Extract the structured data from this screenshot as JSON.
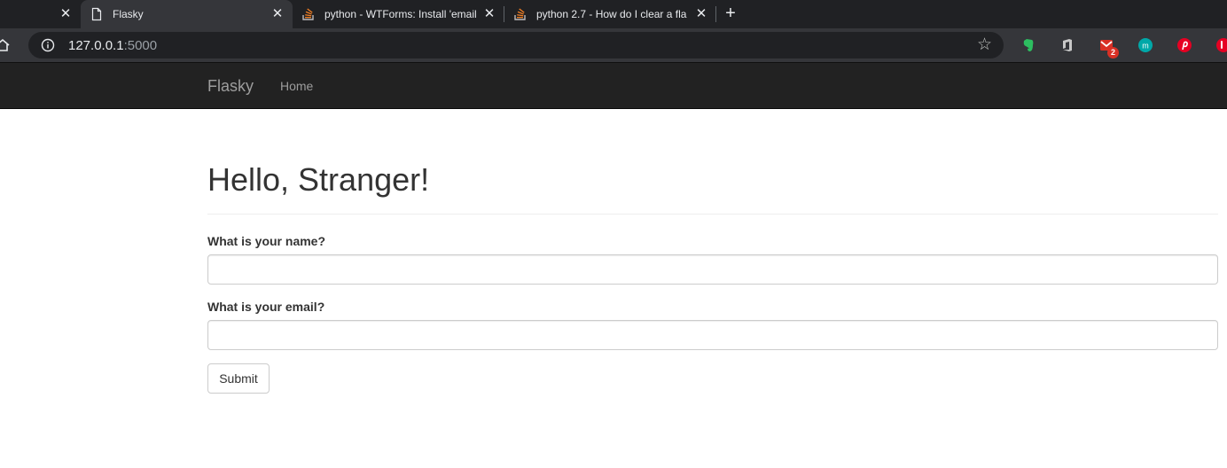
{
  "browser": {
    "tabs": [
      {
        "title": "Flasky",
        "active": true
      },
      {
        "title": "python - WTForms: Install 'email",
        "active": false
      },
      {
        "title": "python 2.7 - How do I clear a fla",
        "active": false
      }
    ],
    "close_glyph": "✕",
    "new_tab_glyph": "+",
    "address": {
      "host": "127.0.0.1",
      "port": ":5000"
    },
    "bookmark_glyph": "☆",
    "extensions": [
      {
        "name": "evernote-icon",
        "color": "#2dbe60"
      },
      {
        "name": "office-icon",
        "color": "#c8c8c8"
      },
      {
        "name": "gmail-checker-icon",
        "color": "#d93025",
        "badge": "2"
      },
      {
        "name": "mention-icon",
        "color": "#00a8a8"
      },
      {
        "name": "pinterest-icon",
        "color": "#e60023"
      },
      {
        "name": "extension-red-icon",
        "color": "#e60023"
      }
    ]
  },
  "navbar": {
    "brand": "Flasky",
    "links": [
      "Home"
    ]
  },
  "page": {
    "heading": "Hello, Stranger!",
    "form": {
      "name_label": "What is your name?",
      "name_value": "",
      "email_label": "What is your email?",
      "email_value": "",
      "submit_label": "Submit"
    }
  },
  "colors": {
    "navbar_bg": "#222222",
    "navbar_text": "#9d9d9d",
    "heading_text": "#333333",
    "browser_dark": "#202124",
    "browser_toolbar": "#35363a"
  }
}
